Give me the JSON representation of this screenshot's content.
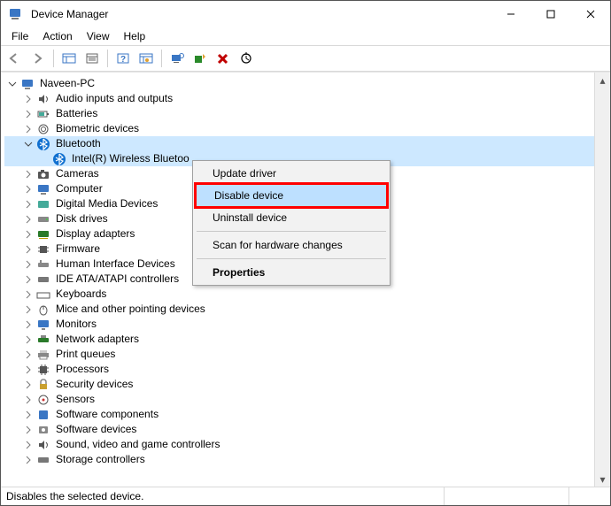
{
  "title": "Device Manager",
  "menu": {
    "file": "File",
    "action": "Action",
    "view": "View",
    "help": "Help"
  },
  "status": "Disables the selected device.",
  "context_menu": {
    "update": "Update driver",
    "disable": "Disable device",
    "uninstall": "Uninstall device",
    "scan": "Scan for hardware changes",
    "properties": "Properties"
  },
  "tree": {
    "root": "Naveen-PC",
    "audio": "Audio inputs and outputs",
    "batteries": "Batteries",
    "biometric": "Biometric devices",
    "bluetooth": "Bluetooth",
    "bt_device": "Intel(R) Wireless Bluetoo",
    "cameras": "Cameras",
    "computer": "Computer",
    "digital_media": "Digital Media Devices",
    "disk_drives": "Disk drives",
    "display_adapters": "Display adapters",
    "firmware": "Firmware",
    "hid": "Human Interface Devices",
    "ide": "IDE ATA/ATAPI controllers",
    "keyboards": "Keyboards",
    "mice": "Mice and other pointing devices",
    "monitors": "Monitors",
    "network": "Network adapters",
    "print_queues": "Print queues",
    "processors": "Processors",
    "security": "Security devices",
    "sensors": "Sensors",
    "software_components": "Software components",
    "software_devices": "Software devices",
    "sound": "Sound, video and game controllers",
    "storage": "Storage controllers"
  }
}
